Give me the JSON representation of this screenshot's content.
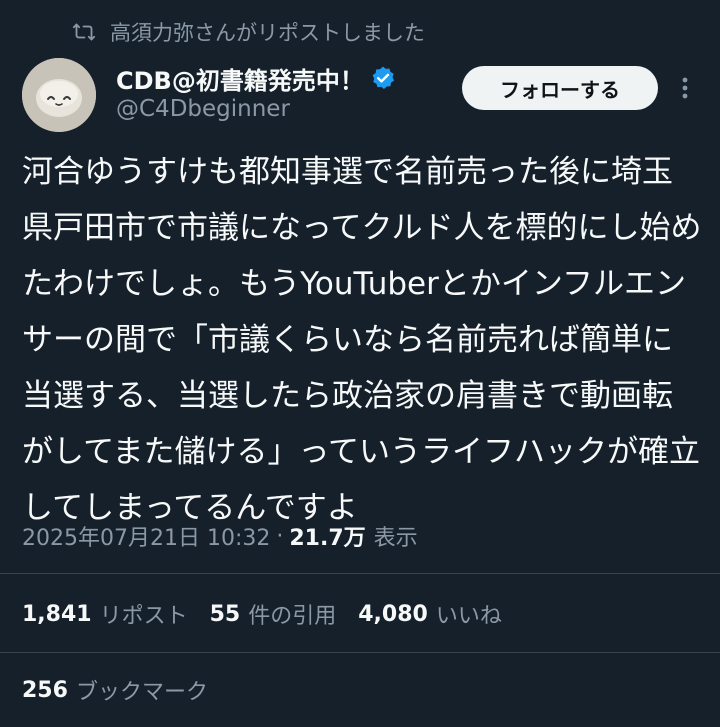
{
  "repost_notice": {
    "icon": "repost-icon",
    "text": "高須力弥さんがリポストしました"
  },
  "author": {
    "avatar_icon": "avatar",
    "display_name": "CDB@初書籍発売中！",
    "verified_icon": "verified-badge-icon",
    "username": "@C4Dbeginner"
  },
  "actions": {
    "follow_label": "フォローする",
    "more_icon": "more-icon"
  },
  "tweet": {
    "text": "河合ゆうすけも都知事選で名前売った後に埼玉県戸田市で市議になってクルド人を標的にし始めたわけでしょ。もうYouTuberとかインフルエンサーの間で「市議くらいなら名前売れば簡単に当選する、当選したら政治家の肩書きで動画転がしてまた儲ける」っていうライフハックが確立してしまってるんですよ"
  },
  "meta": {
    "timestamp": "2025年07月21日 10:32",
    "separator": "·",
    "views_count": "21.7万",
    "views_label": "表示"
  },
  "stats": {
    "reposts_count": "1,841",
    "reposts_label": "リポスト",
    "quotes_count": "55",
    "quotes_label": "件の引用",
    "likes_count": "4,080",
    "likes_label": "いいね",
    "bookmarks_count": "256",
    "bookmarks_label": "ブックマーク"
  },
  "colors": {
    "background": "#15202b",
    "text_primary": "#f7f9f9",
    "text_secondary": "#8b98a5",
    "verified_blue": "#1d9bf0",
    "follow_button_bg": "#eff3f4",
    "divider": "#38444d"
  }
}
